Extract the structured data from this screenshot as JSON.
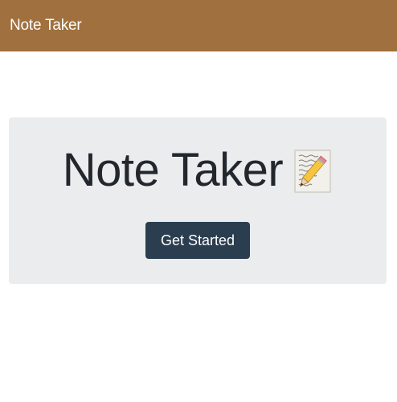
{
  "navbar": {
    "brand": "Note Taker"
  },
  "hero": {
    "title": "Note Taker",
    "title_icon": "memo-icon",
    "button_label": "Get Started"
  },
  "colors": {
    "navbar_bg": "#a0703e",
    "jumbotron_bg": "#eaecee",
    "button_bg": "#2b3e50",
    "text_dark": "#22272e"
  }
}
